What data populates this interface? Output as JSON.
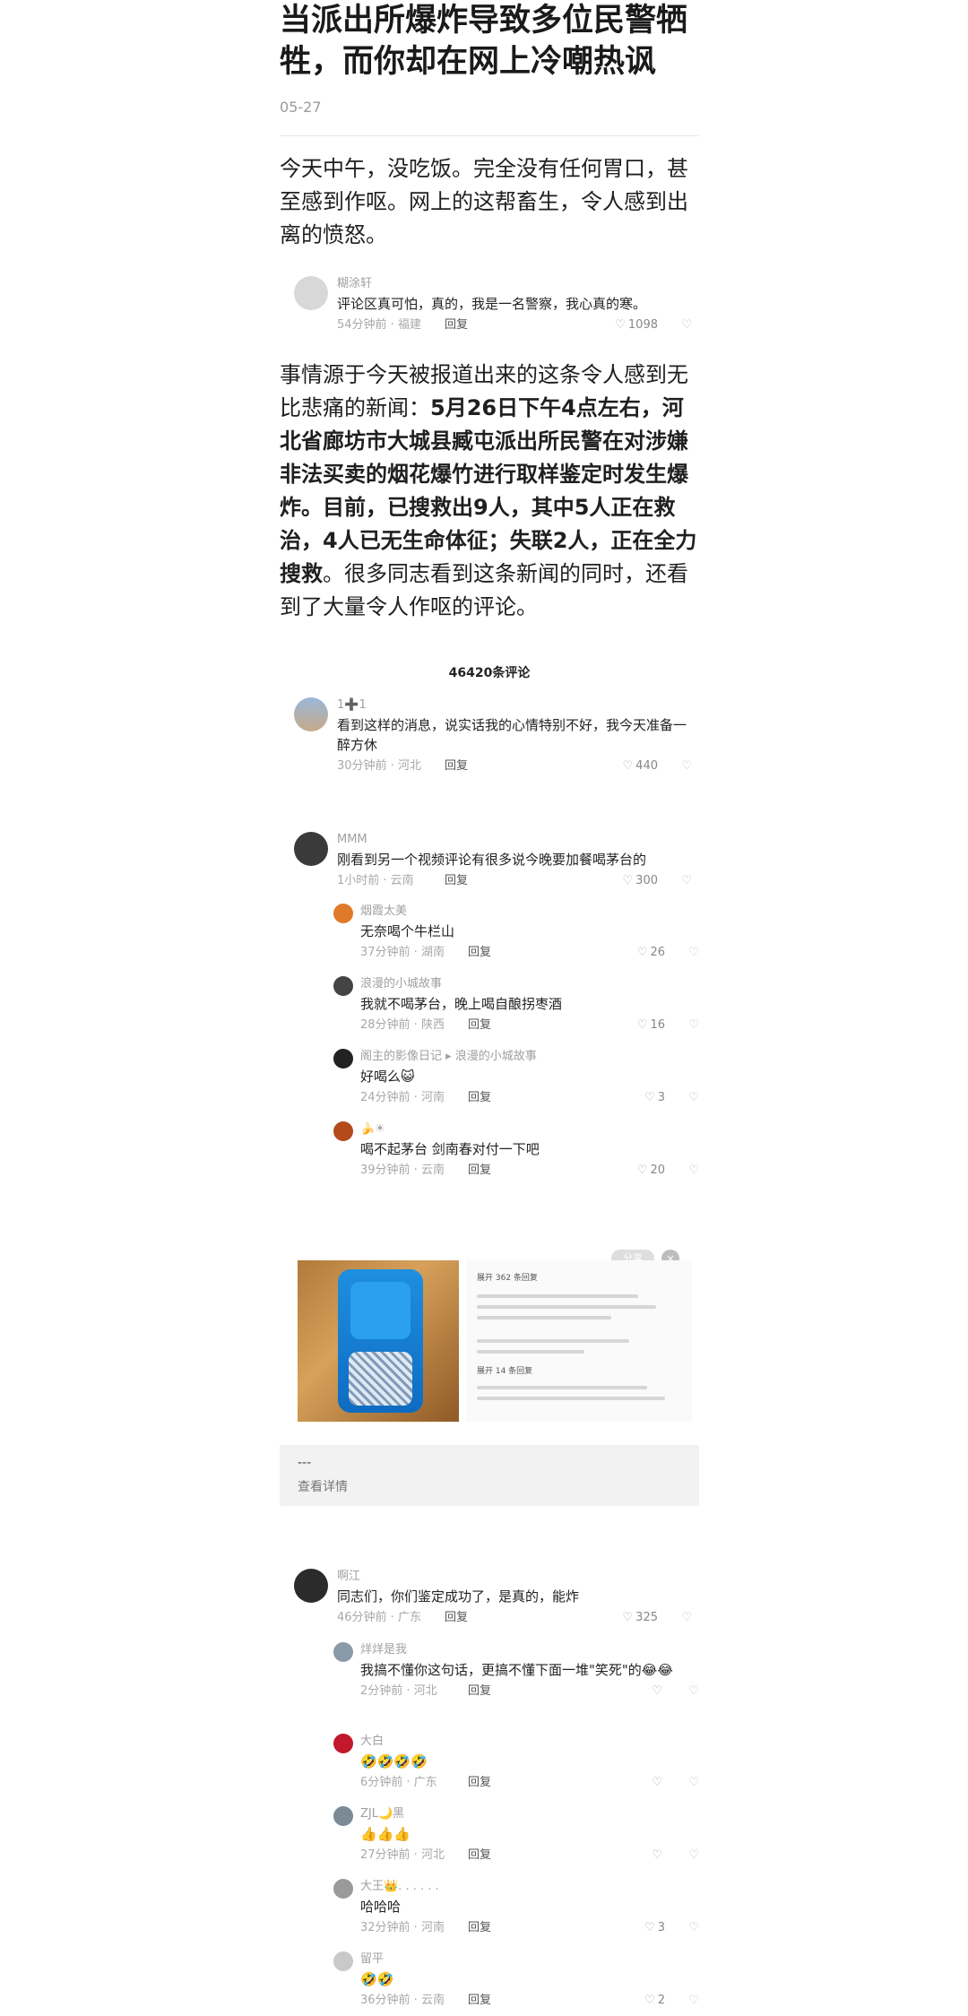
{
  "article": {
    "title": "当派出所爆炸导致多位民警牺牲，而你却在网上冷嘲热讽",
    "date": "05-27",
    "intro": "今天中午，没吃饭。完全没有任何胃口，甚至感到作呕。网上的这帮畜生，令人感到出离的愤怒。",
    "p2_a": "事情源于今天被报道出来的这条令人感到无比悲痛的新闻：",
    "p2_b": "5月26日下午4点左右，河北省廊坊市大城县臧屯派出所民警在对涉嫌非法买卖的烟花爆竹进行取样鉴定时发生爆炸。目前，已搜救出9人，其中5人正在救治，4人已无生命体征；失联2人，正在全力搜救",
    "p2_c": "。很多同志看到这条新闻的同时，还看到了大量令人作呕的评论。"
  },
  "quote_comment": {
    "name": "糊涂轩",
    "text": "评论区真可怕，真的，我是一名警察，我心真的寒。",
    "meta": "54分钟前 · 福建",
    "reply": "回复",
    "likes": "1098"
  },
  "comment_count": "46420条评论",
  "comments": [
    {
      "name": "1➕1",
      "text": "看到这样的消息，说实话我的心情特别不好，我今天准备一醉方休",
      "meta": "30分钟前 · 河北",
      "reply": "回复",
      "likes": "440"
    },
    {
      "name": "MMM",
      "text": "刚看到另一个视频评论有很多说今晚要加餐喝茅台的",
      "meta": "1小时前 · 云南",
      "reply": "回复",
      "likes": "300"
    }
  ],
  "sub_comments_a": [
    {
      "name": "烟霞太美",
      "text": "无奈喝个牛栏山",
      "meta": "37分钟前 · 湖南",
      "reply": "回复",
      "likes": "26"
    },
    {
      "name": "浪漫的小城故事",
      "text": "我就不喝茅台，晚上喝自酿拐枣酒",
      "meta": "28分钟前 · 陕西",
      "reply": "回复",
      "likes": "16"
    },
    {
      "name": "阁主的影像日记 ▸ 浪漫的小城故事",
      "text": "好喝么😺",
      "meta": "24分钟前 · 河南",
      "reply": "回复",
      "likes": "3"
    },
    {
      "name": "🍌☀",
      "text": "喝不起茅台  剑南春对付一下吧",
      "meta": "39分钟前 · 云南",
      "reply": "回复",
      "likes": "20"
    }
  ],
  "image_block": {
    "pill": "分享",
    "close": "×",
    "shot_header": "展开 362 条回复",
    "shot_footer": "展开 14 条回复"
  },
  "detail": {
    "dash": "---",
    "more": "查看详情"
  },
  "comment3": {
    "name": "啊江",
    "text": "同志们，你们鉴定成功了，是真的，能炸",
    "meta": "46分钟前 · 广东",
    "reply": "回复",
    "likes": "325"
  },
  "sub_comments_b": [
    {
      "name": "烊烊是我",
      "text": "我搞不懂你这句话，更搞不懂下面一堆\"笑死\"的😂😂",
      "meta": "2分钟前 · 河北",
      "reply": "回复",
      "likes": ""
    },
    {
      "name": "大白",
      "text": "🤣🤣🤣🤣",
      "meta": "6分钟前 · 广东",
      "reply": "回复",
      "likes": ""
    },
    {
      "name": "ZJL🌙黑",
      "text": "👍👍👍",
      "meta": "27分钟前 · 河北",
      "reply": "回复",
      "likes": ""
    },
    {
      "name": "大王👑. . . . . .",
      "text": "哈哈哈",
      "meta": "32分钟前 · 河南",
      "reply": "回复",
      "likes": "3"
    },
    {
      "name": "留平",
      "text": "🤣🤣",
      "meta": "36分钟前 · 云南",
      "reply": "回复",
      "likes": "2"
    }
  ],
  "icons": {
    "heart": "heart-outline-icon",
    "dislike": "dislike-icon"
  },
  "colors": {
    "text": "#1f1f1f",
    "muted": "#a0a0a0",
    "panel": "#f2f2f2"
  }
}
